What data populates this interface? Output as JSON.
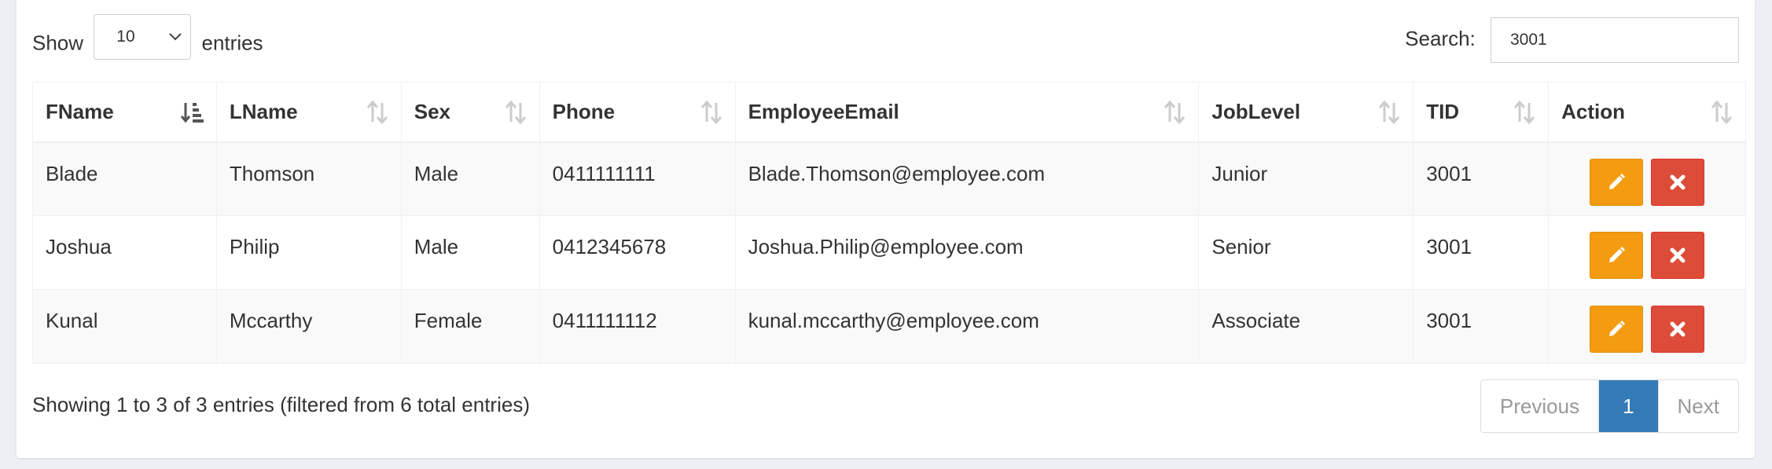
{
  "controls": {
    "show_label": "Show",
    "page_length": "10",
    "entries_label": "entries",
    "search_label": "Search:",
    "search_value": "3001"
  },
  "table": {
    "columns": [
      {
        "label": "FName",
        "sort": "ascending"
      },
      {
        "label": "LName",
        "sort": "none"
      },
      {
        "label": "Sex",
        "sort": "none"
      },
      {
        "label": "Phone",
        "sort": "none"
      },
      {
        "label": "EmployeeEmail",
        "sort": "none"
      },
      {
        "label": "JobLevel",
        "sort": "none"
      },
      {
        "label": "TID",
        "sort": "none"
      },
      {
        "label": "Action",
        "sort": "none"
      }
    ],
    "rows": [
      {
        "fname": "Blade",
        "lname": "Thomson",
        "sex": "Male",
        "phone": "0411111111",
        "email": "Blade.Thomson@employee.com",
        "joblevel": "Junior",
        "tid": "3001"
      },
      {
        "fname": "Joshua",
        "lname": "Philip",
        "sex": "Male",
        "phone": "0412345678",
        "email": "Joshua.Philip@employee.com",
        "joblevel": "Senior",
        "tid": "3001"
      },
      {
        "fname": "Kunal",
        "lname": "Mccarthy",
        "sex": "Female",
        "phone": "0411111112",
        "email": "kunal.mccarthy@employee.com",
        "joblevel": "Associate",
        "tid": "3001"
      }
    ],
    "action_icons": {
      "edit": "pencil-icon",
      "delete": "times-icon"
    }
  },
  "footer": {
    "info": "Showing 1 to 3 of 3 entries (filtered from 6 total entries)",
    "pagination": {
      "previous": "Previous",
      "current": "1",
      "next": "Next"
    }
  },
  "colors": {
    "edit_button": "#f39c12",
    "delete_button": "#dd4b39",
    "active_page": "#337ab7",
    "page_background": "#ecf0f5"
  }
}
